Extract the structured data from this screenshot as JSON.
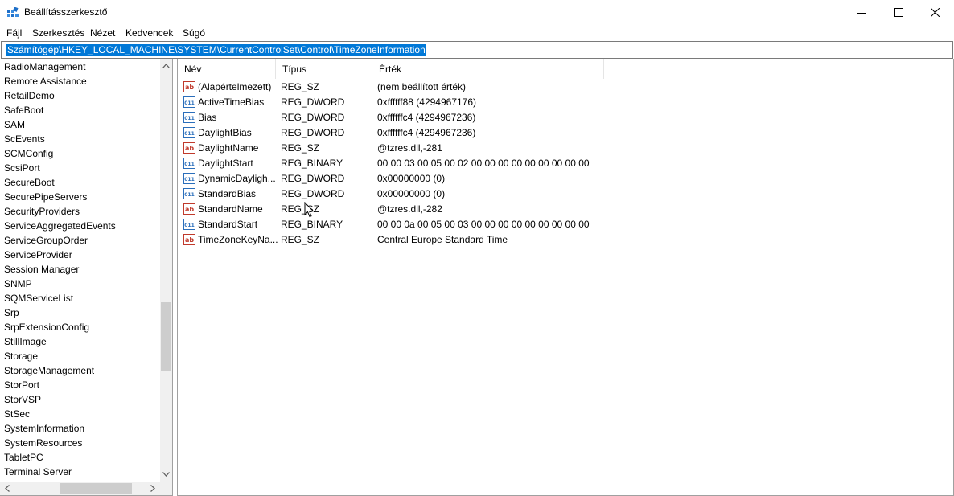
{
  "window": {
    "title": "Beállításszerkesztő",
    "controls": [
      "minimize",
      "maximize",
      "close"
    ]
  },
  "menu": [
    "Fájl",
    "Szerkesztés",
    "Nézet",
    "Kedvencek",
    "Súgó"
  ],
  "address": "Számítógép\\HKEY_LOCAL_MACHINE\\SYSTEM\\CurrentControlSet\\Control\\TimeZoneInformation",
  "tree": [
    "RadioManagement",
    "Remote Assistance",
    "RetailDemo",
    "SafeBoot",
    "SAM",
    "ScEvents",
    "SCMConfig",
    "ScsiPort",
    "SecureBoot",
    "SecurePipeServers",
    "SecurityProviders",
    "ServiceAggregatedEvents",
    "ServiceGroupOrder",
    "ServiceProvider",
    "Session Manager",
    "SNMP",
    "SQMServiceList",
    "Srp",
    "SrpExtensionConfig",
    "StillImage",
    "Storage",
    "StorageManagement",
    "StorPort",
    "StorVSP",
    "StSec",
    "SystemInformation",
    "SystemResources",
    "TabletPC",
    "Terminal Server"
  ],
  "columns": {
    "name": "Név",
    "type": "Típus",
    "value": "Érték"
  },
  "values": [
    {
      "icon": "string-value-icon",
      "name": "(Alapértelmezett)",
      "type": "REG_SZ",
      "data": "(nem beállított érték)"
    },
    {
      "icon": "binary-value-icon",
      "name": "ActiveTimeBias",
      "type": "REG_DWORD",
      "data": "0xffffff88 (4294967176)"
    },
    {
      "icon": "binary-value-icon",
      "name": "Bias",
      "type": "REG_DWORD",
      "data": "0xffffffc4 (4294967236)"
    },
    {
      "icon": "binary-value-icon",
      "name": "DaylightBias",
      "type": "REG_DWORD",
      "data": "0xffffffc4 (4294967236)"
    },
    {
      "icon": "string-value-icon",
      "name": "DaylightName",
      "type": "REG_SZ",
      "data": "@tzres.dll,-281"
    },
    {
      "icon": "binary-value-icon",
      "name": "DaylightStart",
      "type": "REG_BINARY",
      "data": "00 00 03 00 05 00 02 00 00 00 00 00 00 00 00 00"
    },
    {
      "icon": "binary-value-icon",
      "name": "DynamicDayligh...",
      "type": "REG_DWORD",
      "data": "0x00000000 (0)"
    },
    {
      "icon": "binary-value-icon",
      "name": "StandardBias",
      "type": "REG_DWORD",
      "data": "0x00000000 (0)"
    },
    {
      "icon": "string-value-icon",
      "name": "StandardName",
      "type": "REG_SZ",
      "data": "@tzres.dll,-282"
    },
    {
      "icon": "binary-value-icon",
      "name": "StandardStart",
      "type": "REG_BINARY",
      "data": "00 00 0a 00 05 00 03 00 00 00 00 00 00 00 00 00"
    },
    {
      "icon": "string-value-icon",
      "name": "TimeZoneKeyNa...",
      "type": "REG_SZ",
      "data": "Central Europe Standard Time"
    }
  ],
  "colors": {
    "selection": "#0078d7",
    "scrollbar": "#f0f0f0",
    "thumb": "#cdcdcd"
  }
}
